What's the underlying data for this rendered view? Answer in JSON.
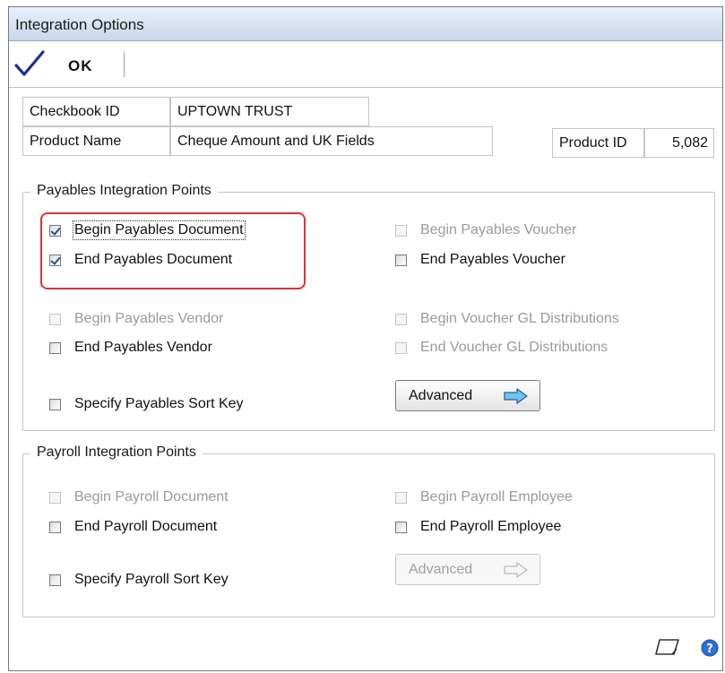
{
  "window": {
    "title": "Integration Options"
  },
  "toolbar": {
    "ok_label": "OK"
  },
  "fields": {
    "checkbook_label": "Checkbook ID",
    "checkbook_value": "UPTOWN TRUST",
    "product_name_label": "Product Name",
    "product_name_value": "Cheque Amount and UK Fields",
    "product_id_label": "Product ID",
    "product_id_value": "5,082"
  },
  "payables": {
    "legend": "Payables Integration Points",
    "options": [
      {
        "label": "Begin Payables Document",
        "checked": true,
        "enabled": true
      },
      {
        "label": "End Payables Document",
        "checked": true,
        "enabled": true
      },
      {
        "label": "Begin Payables Vendor",
        "checked": false,
        "enabled": false
      },
      {
        "label": "End Payables Vendor",
        "checked": false,
        "enabled": true
      },
      {
        "label": "Specify Payables Sort Key",
        "checked": false,
        "enabled": true
      },
      {
        "label": "Begin Payables Voucher",
        "checked": false,
        "enabled": false
      },
      {
        "label": "End Payables Voucher",
        "checked": false,
        "enabled": true
      },
      {
        "label": "Begin Voucher GL Distributions",
        "checked": false,
        "enabled": false
      },
      {
        "label": "End Voucher GL Distributions",
        "checked": false,
        "enabled": false
      }
    ],
    "advanced_label": "Advanced",
    "advanced_enabled": true
  },
  "payroll": {
    "legend": "Payroll Integration Points",
    "options": [
      {
        "label": "Begin Payroll Document",
        "checked": false,
        "enabled": false
      },
      {
        "label": "End Payroll Document",
        "checked": false,
        "enabled": true
      },
      {
        "label": "Specify Payroll Sort Key",
        "checked": false,
        "enabled": true
      },
      {
        "label": "Begin Payroll Employee",
        "checked": false,
        "enabled": false
      },
      {
        "label": "End Payroll Employee",
        "checked": false,
        "enabled": true
      }
    ],
    "advanced_label": "Advanced",
    "advanced_enabled": false
  },
  "icons": {
    "ok": "checkmark-icon",
    "advanced": "right-arrow-icon",
    "note": "note-icon",
    "help": "help-icon"
  },
  "colors": {
    "highlight": "#e0303a",
    "checkmark": "#1f2f8f",
    "arrow_fill": "#6cc6f0"
  }
}
